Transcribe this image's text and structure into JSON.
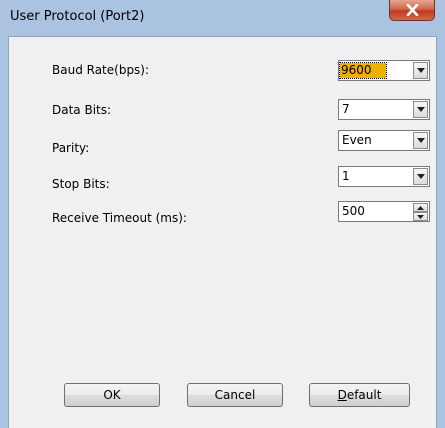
{
  "window": {
    "title": "User Protocol (Port2)"
  },
  "fields": [
    {
      "label": "Baud Rate(bps):",
      "value": "9600"
    },
    {
      "label": "Data Bits:",
      "value": "7"
    },
    {
      "label": "Parity:",
      "value": "Even"
    },
    {
      "label": "Stop Bits:",
      "value": "1"
    },
    {
      "label": "Receive Timeout (ms):",
      "value": "500"
    }
  ],
  "buttons": {
    "ok": "OK",
    "cancel": "Cancel",
    "default_mnemonic": "D",
    "default_rest": "efault"
  },
  "icons": {
    "close": "close-icon",
    "dropdown": "chevron-down-icon",
    "spin_up": "arrow-up-icon",
    "spin_down": "arrow-down-icon"
  }
}
